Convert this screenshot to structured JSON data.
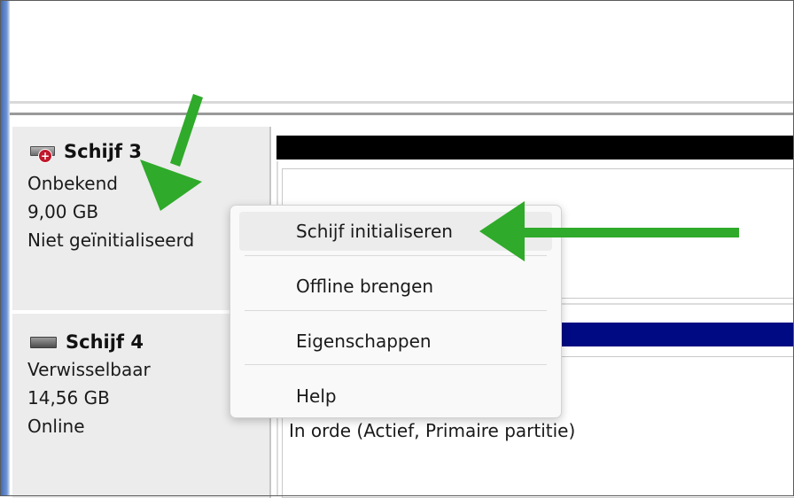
{
  "disks": [
    {
      "name": "Schijf 3",
      "type": "Onbekend",
      "size": "9,00 GB",
      "status": "Niet geïnitialiseerd",
      "icon": "disk-error-icon"
    },
    {
      "name": "Schijf 4",
      "type": "Verwisselbaar",
      "size": "14,56 GB",
      "status": "Online",
      "icon": "disk-icon"
    }
  ],
  "volume": {
    "status": "In orde (Actief, Primaire partitie)"
  },
  "context_menu": {
    "items": [
      {
        "label": "Schijf initialiseren"
      },
      {
        "label": "Offline brengen"
      },
      {
        "label": "Eigenschappen"
      },
      {
        "label": "Help"
      }
    ]
  },
  "colors": {
    "arrow": "#2faa2a",
    "unallocated_bar": "#000000",
    "primary_partition_bar": "#000a82"
  }
}
